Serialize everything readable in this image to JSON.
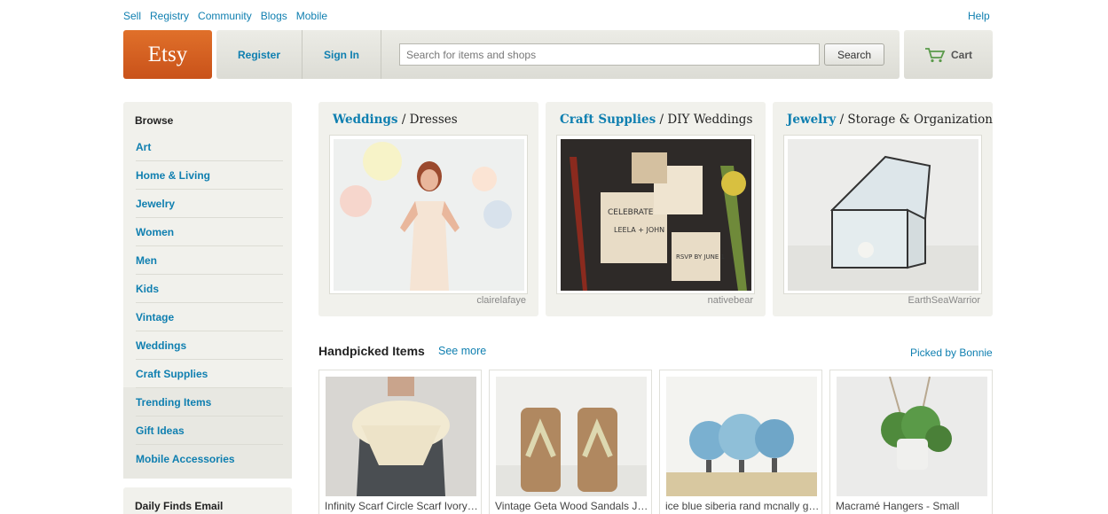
{
  "top_nav": {
    "links": [
      "Sell",
      "Registry",
      "Community",
      "Blogs",
      "Mobile"
    ],
    "help": "Help"
  },
  "header": {
    "logo": "Etsy",
    "register": "Register",
    "sign_in": "Sign In",
    "search_placeholder": "Search for items and shops",
    "search_button": "Search",
    "cart": "Cart",
    "cart_icon": "cart-icon"
  },
  "sidebar": {
    "title": "Browse",
    "items": [
      {
        "label": "Art"
      },
      {
        "label": "Home & Living"
      },
      {
        "label": "Jewelry"
      },
      {
        "label": "Women"
      },
      {
        "label": "Men"
      },
      {
        "label": "Kids"
      },
      {
        "label": "Vintage"
      },
      {
        "label": "Weddings"
      },
      {
        "label": "Craft Supplies"
      },
      {
        "label": "Trending Items"
      },
      {
        "label": "Gift Ideas"
      },
      {
        "label": "Mobile Accessories"
      }
    ],
    "daily_title": "Daily Finds Email"
  },
  "features": [
    {
      "category": "Weddings",
      "subcategory": "Dresses",
      "credit": "clairelafaye"
    },
    {
      "category": "Craft Supplies",
      "subcategory": "DIY Weddings",
      "credit": "nativebear"
    },
    {
      "category": "Jewelry",
      "subcategory": "Storage & Organization",
      "credit": "EarthSeaWarrior"
    }
  ],
  "handpicked": {
    "title": "Handpicked Items",
    "see_more": "See more",
    "picked_by": "Picked by Bonnie",
    "items": [
      {
        "title": "Infinity Scarf Circle Scarf Ivory Cream"
      },
      {
        "title": "Vintage Geta Wood Sandals Japanese"
      },
      {
        "title": "ice blue siberia rand mcnally globe"
      },
      {
        "title": "Macramé Hangers - Small"
      }
    ]
  },
  "colors": {
    "link": "#0f7fb0",
    "brand_orange": "#d45d20",
    "panel_bg": "#f1f1ec"
  }
}
